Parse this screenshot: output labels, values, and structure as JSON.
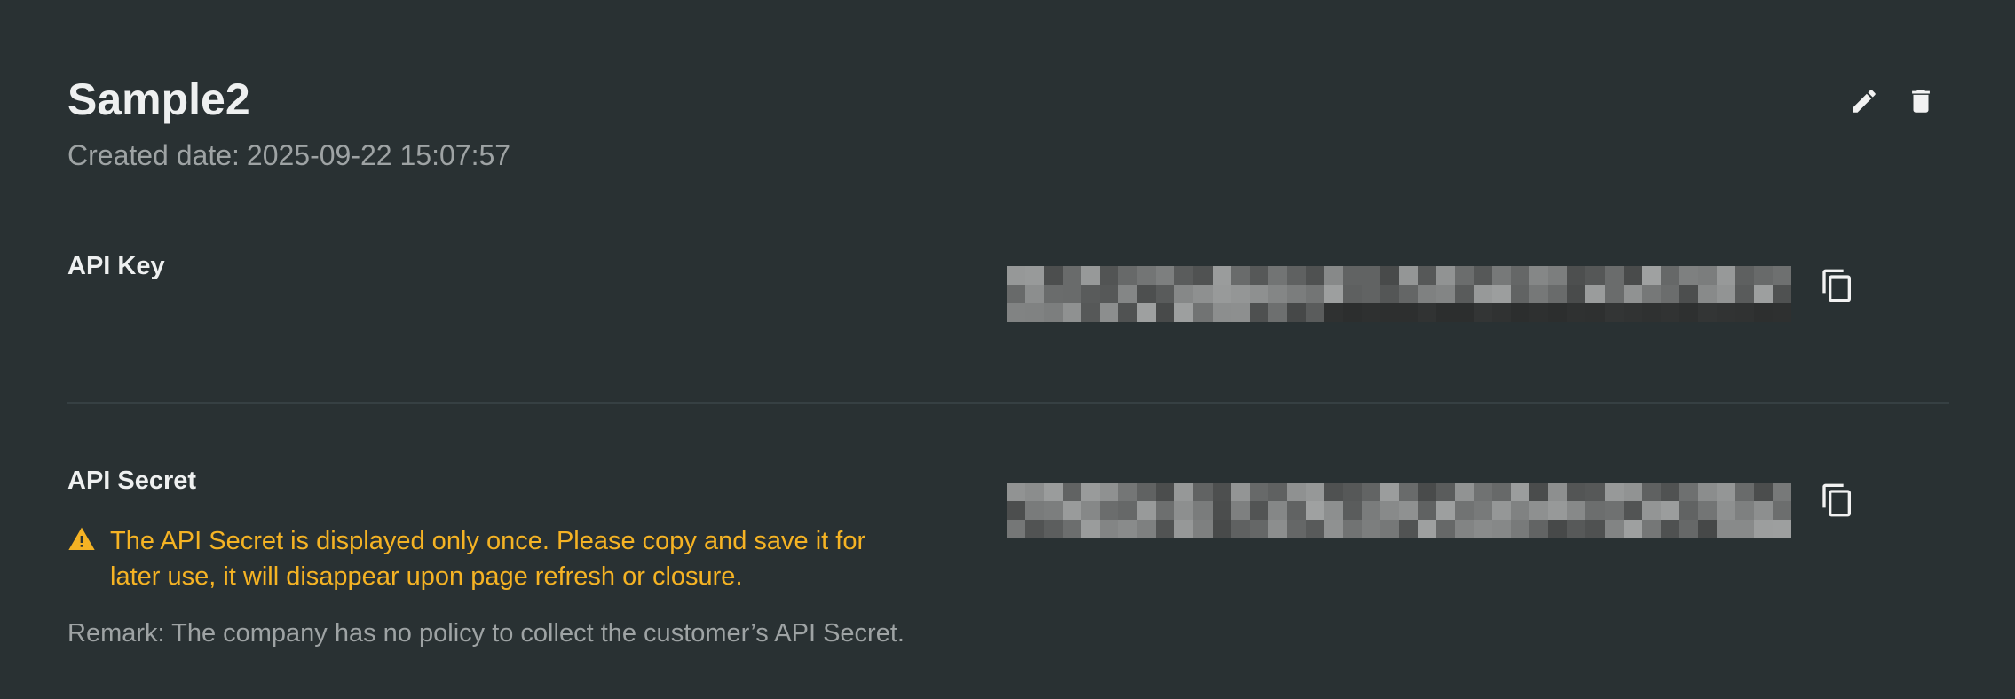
{
  "header": {
    "title": "Sample2",
    "created_label": "Created date:",
    "created_value": "2025-09-22 15:07:57",
    "edit_icon": "pencil-icon",
    "delete_icon": "trash-icon"
  },
  "api_key": {
    "label": "API Key",
    "value_state": "pixelated/redacted",
    "copy_icon": "copy-icon"
  },
  "api_secret": {
    "label": "API Secret",
    "value_state": "pixelated/redacted",
    "copy_icon": "copy-icon",
    "warning_icon": "warning-triangle-icon",
    "warning": "The API Secret is displayed only once. Please copy and save it for later use, it will disappear upon page refresh or closure.",
    "remark": "Remark: The company has no policy to collect the customer’s API Secret."
  },
  "colors": {
    "background": "#293133",
    "title_text": "#eef0f0",
    "muted_text": "#9ea3a4",
    "warning": "#f5b324",
    "divider": "#364043"
  }
}
